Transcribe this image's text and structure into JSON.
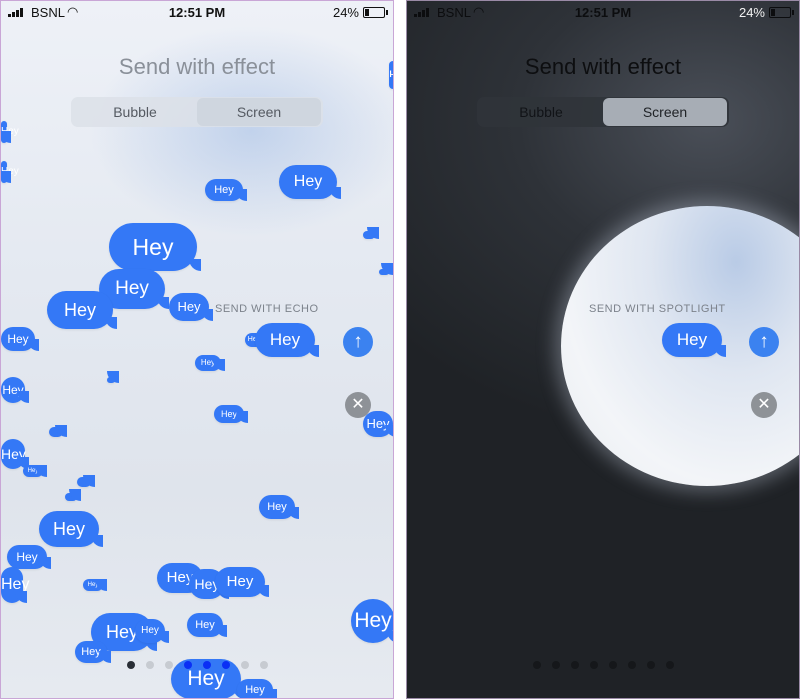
{
  "status": {
    "carrier": "BSNL",
    "time": "12:51 PM",
    "battery": "24%"
  },
  "left": {
    "title": "Send with effect",
    "tabs": {
      "bubble": "Bubble",
      "screen": "Screen",
      "active": "screen"
    },
    "effect_label": "SEND WITH ECHO",
    "message": "Hey",
    "page_dots": {
      "count": 8,
      "current": 0,
      "highlighted": [
        3,
        4,
        5
      ]
    }
  },
  "right": {
    "title": "Send with effect",
    "tabs": {
      "bubble": "Bubble",
      "screen": "Screen",
      "active": "screen"
    },
    "effect_label": "SEND WITH SPOTLIGHT",
    "message": "Hey",
    "page_dots": {
      "count": 8
    }
  },
  "icons": {
    "send": "arrow-up-icon",
    "close": "close-icon",
    "signal": "cellular-signal-icon",
    "wifi": "wifi-icon",
    "battery": "battery-icon"
  },
  "colors": {
    "bubble_blue": "#3478f6",
    "send_blue": "#3b82f0",
    "dot_highlight": "#0a2ff5"
  }
}
